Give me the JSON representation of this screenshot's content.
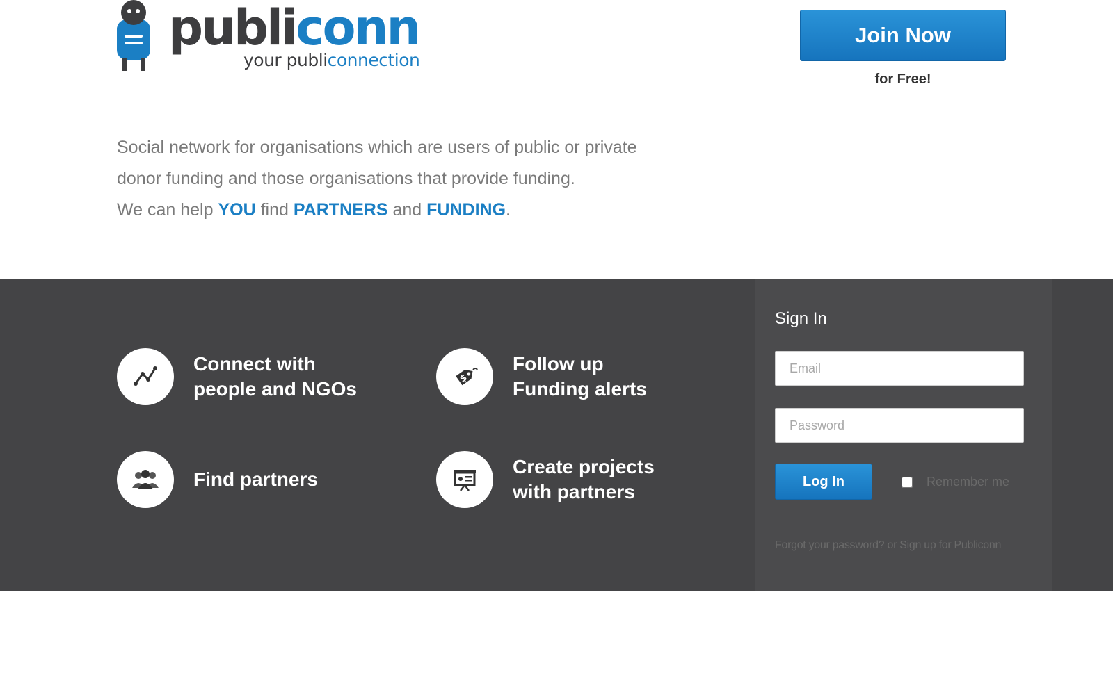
{
  "header": {
    "brand_part1": "publi",
    "brand_part2": "conn",
    "tagline_part1": "your publi",
    "tagline_part2": "connection",
    "join_button": "Join Now",
    "join_subtext": "for Free!"
  },
  "intro": {
    "line1": "Social network for organisations which are users of public or private",
    "line2": "donor funding and those organisations that provide funding.",
    "line3_prefix": "We can help ",
    "line3_you": "YOU",
    "line3_find": " find ",
    "line3_partners": "PARTNERS",
    "line3_and": " and ",
    "line3_funding": "FUNDING",
    "line3_period": "."
  },
  "features": [
    {
      "icon": "network-chart-icon",
      "line1": "Connect with",
      "line2": "people and NGOs"
    },
    {
      "icon": "price-tag-icon",
      "line1": "Follow up",
      "line2": "Funding alerts"
    },
    {
      "icon": "people-group-icon",
      "line1": "Find partners"
    },
    {
      "icon": "presentation-board-icon",
      "line1": "Create projects",
      "line2": "with partners"
    }
  ],
  "signin": {
    "title": "Sign In",
    "email_placeholder": "Email",
    "password_placeholder": "Password",
    "login_button": "Log In",
    "remember_label": "Remember me",
    "forgot_link": "Forgot your password?",
    "or_text": " or ",
    "signup_link": "Sign up for Publiconn"
  },
  "colors": {
    "accent": "#1b7fc4",
    "band": "#444446",
    "panel": "#4b4b4d"
  }
}
